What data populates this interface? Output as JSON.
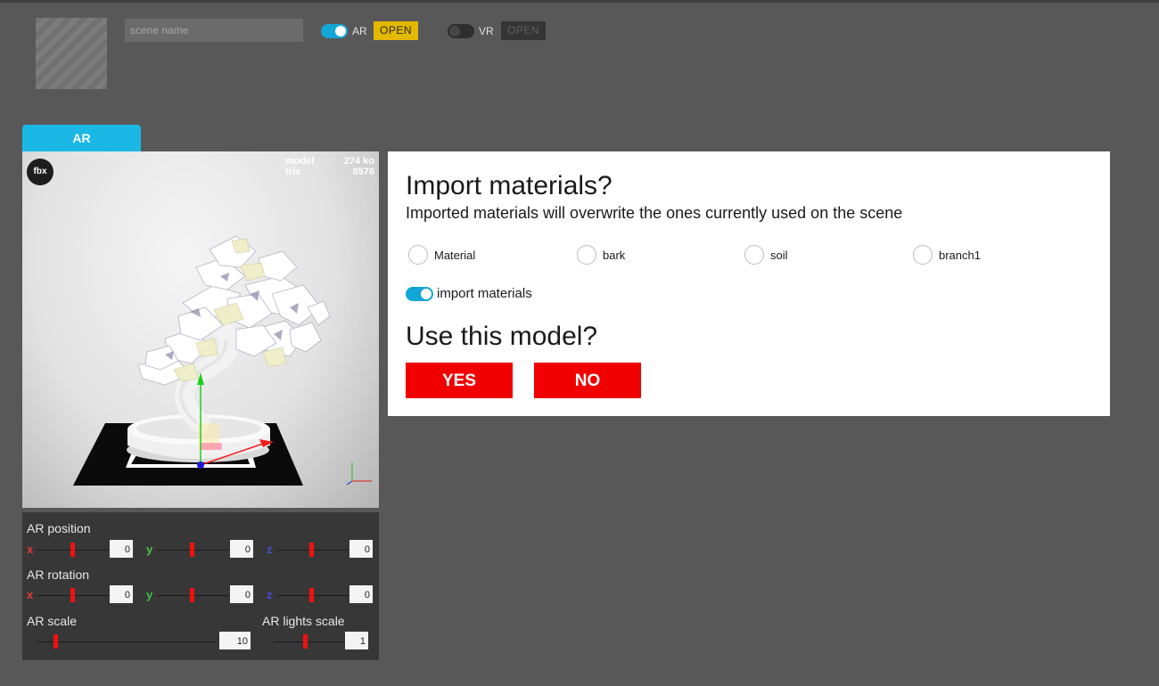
{
  "header": {
    "scene_name_placeholder": "scene name",
    "ar": {
      "label": "AR",
      "enabled": true,
      "open_label": "OPEN"
    },
    "vr": {
      "label": "VR",
      "enabled": false,
      "open_label": "OPEN"
    }
  },
  "tabs": [
    {
      "label": "AR",
      "active": true
    }
  ],
  "viewport": {
    "format_badge": "fbx",
    "stats": [
      {
        "label": "model",
        "value": "274 ko"
      },
      {
        "label": "tris",
        "value": "8576"
      }
    ]
  },
  "controls": {
    "position": {
      "label": "AR position",
      "x": "0",
      "y": "0",
      "z": "0"
    },
    "rotation": {
      "label": "AR rotation",
      "x": "0",
      "y": "0",
      "z": "0"
    },
    "scale": {
      "label": "AR scale",
      "value": "10"
    },
    "lights_scale": {
      "label": "AR lights scale",
      "value": "1"
    },
    "axis_labels": {
      "x": "x",
      "y": "y",
      "z": "z"
    }
  },
  "dialog": {
    "title": "Import materials?",
    "subtitle": "Imported materials will overwrite the ones currently used on the scene",
    "materials": [
      "Material",
      "bark",
      "soil",
      "branch1"
    ],
    "import_toggle_label": "import materials",
    "import_toggle_on": true,
    "question": "Use this model?",
    "yes_label": "YES",
    "no_label": "NO"
  },
  "colors": {
    "accent": "#12a7d4",
    "tab": "#1bb8e6",
    "open_ar": "#e2b800",
    "danger": "#f00000",
    "background": "#585858"
  }
}
